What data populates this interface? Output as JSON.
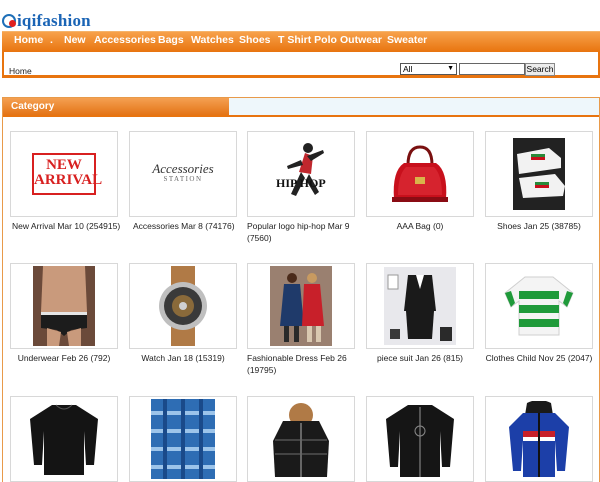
{
  "brand": {
    "logo_text": "iqifashion"
  },
  "nav": [
    {
      "label": "Home"
    },
    {
      "label": "."
    },
    {
      "label": "New"
    },
    {
      "label": "Accessories"
    },
    {
      "label": "Bags"
    },
    {
      "label": "Watches"
    },
    {
      "label": "Shoes"
    },
    {
      "label": "T Shirt Polo"
    },
    {
      "label": "Outwear"
    },
    {
      "label": "Sweater"
    }
  ],
  "breadcrumb": {
    "home": "Home"
  },
  "search": {
    "category_selected": "All",
    "query": "",
    "button_label": "Search"
  },
  "category": {
    "title": "Category"
  },
  "products": [
    {
      "caption": "New Arrival Mar 10 (254915)",
      "thumb_text_1": "NEW",
      "thumb_text_2": "ARRIVAL"
    },
    {
      "caption": "Accessories Mar 8 (74176)",
      "thumb_text_1": "Accessories",
      "thumb_text_2": "STATION"
    },
    {
      "caption": "Popular logo hip-hop Mar 9 (7560)",
      "thumb_text_1": "HIP HOP"
    },
    {
      "caption": "AAA Bag (0)"
    },
    {
      "caption": "Shoes Jan 25 (38785)"
    },
    {
      "caption": "Underwear Feb 26 (792)"
    },
    {
      "caption": "Watch Jan 18 (15319)"
    },
    {
      "caption": "Fashionable Dress Feb 26 (19795)"
    },
    {
      "caption": "piece suit Jan 26 (815)"
    },
    {
      "caption": "Clothes Child Nov 25 (2047)"
    },
    {
      "caption": ""
    },
    {
      "caption": ""
    },
    {
      "caption": ""
    },
    {
      "caption": ""
    },
    {
      "caption": ""
    }
  ]
}
